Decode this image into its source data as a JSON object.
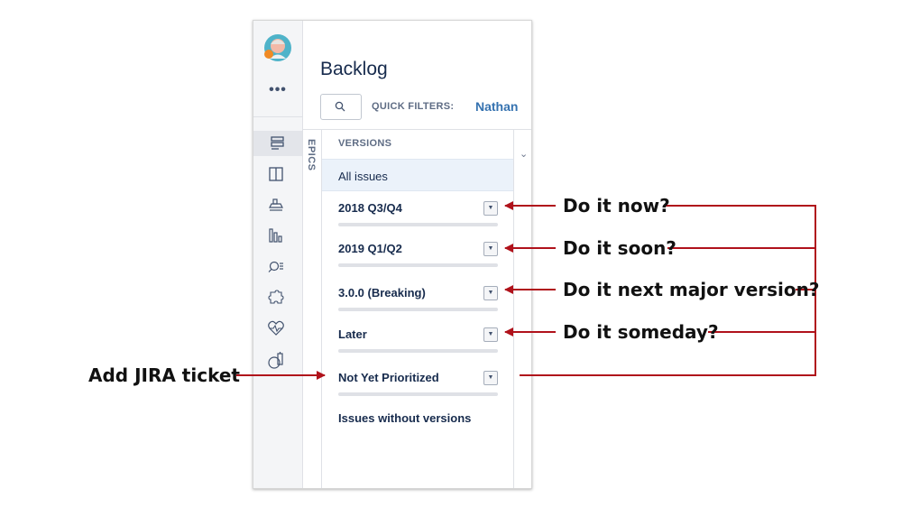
{
  "sidebar": {
    "avatar_icon": "user-avatar",
    "more_label": "•••",
    "items": [
      {
        "icon": "backlog-icon",
        "active": true
      },
      {
        "icon": "board-icon"
      },
      {
        "icon": "releases-icon"
      },
      {
        "icon": "reports-icon"
      },
      {
        "icon": "issues-search-icon"
      },
      {
        "icon": "addons-icon"
      },
      {
        "icon": "health-icon"
      },
      {
        "icon": "settings-icon"
      }
    ]
  },
  "header": {
    "title": "Backlog",
    "quick_filters_label": "QUICK FILTERS:",
    "quick_filter_user": "Nathan"
  },
  "epics": {
    "label": "EPICS"
  },
  "versions": {
    "heading": "VERSIONS",
    "all_issues": "All issues",
    "items": [
      {
        "name": "2018 Q3/Q4"
      },
      {
        "name": "2019 Q1/Q2"
      },
      {
        "name": "3.0.0 (Breaking)"
      },
      {
        "name": "Later"
      },
      {
        "name": "Not Yet Prioritized"
      }
    ],
    "without_versions": "Issues without versions"
  },
  "annotations": {
    "do_it_now": "Do it now?",
    "do_it_soon": "Do it soon?",
    "do_it_next_major": "Do it next major version?",
    "do_it_someday": "Do it someday?",
    "add_jira_ticket": "Add JIRA ticket"
  },
  "colors": {
    "arrow": "#b0121b",
    "accent_link": "#3572b0",
    "selected_row": "#ebf2fa"
  }
}
